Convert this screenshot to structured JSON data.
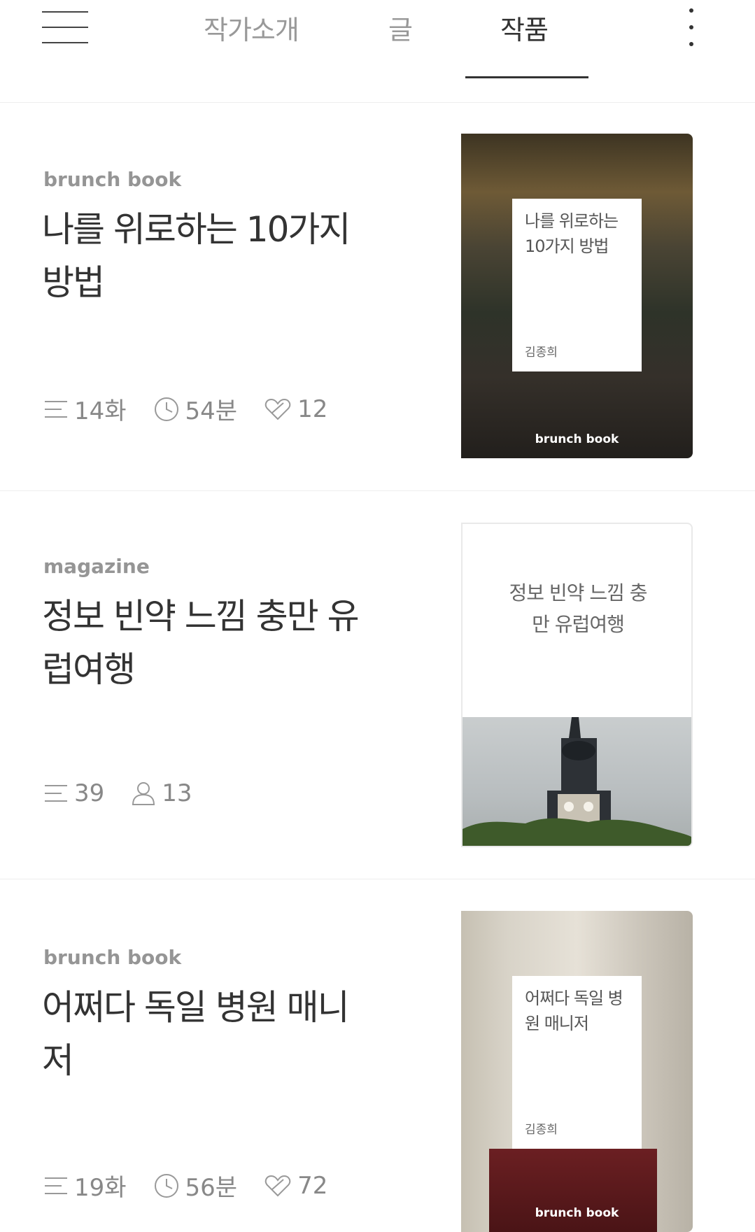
{
  "tabs": [
    {
      "label": "작가소개"
    },
    {
      "label": "글"
    },
    {
      "label": "작품"
    }
  ],
  "active_tab": "작품",
  "items": [
    {
      "type": "brunch book",
      "title": "나를 위로하는 10가지 방법",
      "episodes": "14화",
      "duration": "54분",
      "likes": "12",
      "cover": {
        "title": "나를 위로하는 10가지 방법",
        "author": "김종희",
        "brand": "brunch book"
      }
    },
    {
      "type": "magazine",
      "title": "정보 빈약 느낌 충만 유럽여행",
      "episodes": "39",
      "subscribers": "13",
      "cover": {
        "title": "정보 빈약 느낌 충만 유럽여행"
      }
    },
    {
      "type": "brunch book",
      "title": "어쩌다 독일 병원 매니저",
      "episodes": "19화",
      "duration": "56분",
      "likes": "72",
      "cover": {
        "title": "어쩌다 독일 병원 매니저",
        "author": "김종희",
        "brand": "brunch book"
      }
    }
  ]
}
